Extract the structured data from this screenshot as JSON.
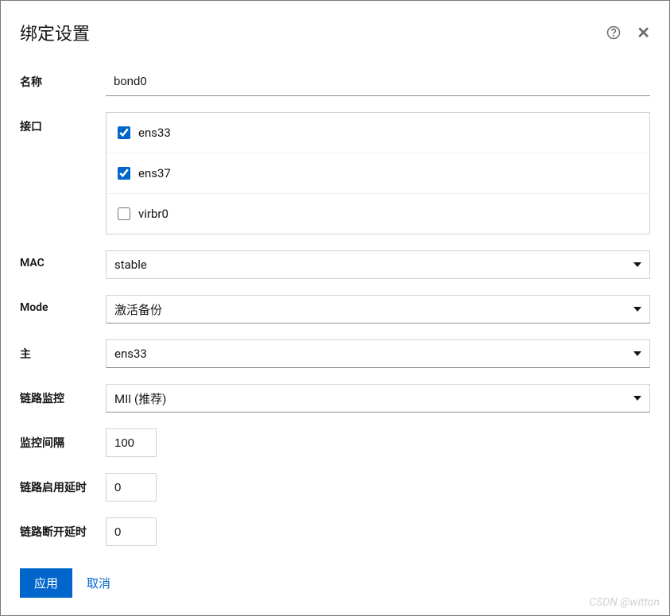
{
  "header": {
    "title": "绑定设置"
  },
  "fields": {
    "name": {
      "label": "名称",
      "value": "bond0"
    },
    "interfaces": {
      "label": "接口",
      "items": [
        {
          "name": "ens33",
          "checked": true
        },
        {
          "name": "ens37",
          "checked": true
        },
        {
          "name": "virbr0",
          "checked": false
        }
      ]
    },
    "mac": {
      "label": "MAC",
      "value": "stable"
    },
    "mode": {
      "label": "Mode",
      "value": "激活备份"
    },
    "primary": {
      "label": "主",
      "value": "ens33"
    },
    "linkMonitor": {
      "label": "链路监控",
      "value": "MII (推荐)"
    },
    "monitorInterval": {
      "label": "监控间隔",
      "value": "100"
    },
    "linkUpDelay": {
      "label": "链路启用延时",
      "value": "0"
    },
    "linkDownDelay": {
      "label": "链路断开延时",
      "value": "0"
    }
  },
  "actions": {
    "apply": "应用",
    "cancel": "取消"
  },
  "watermark": "CSDN @witton"
}
